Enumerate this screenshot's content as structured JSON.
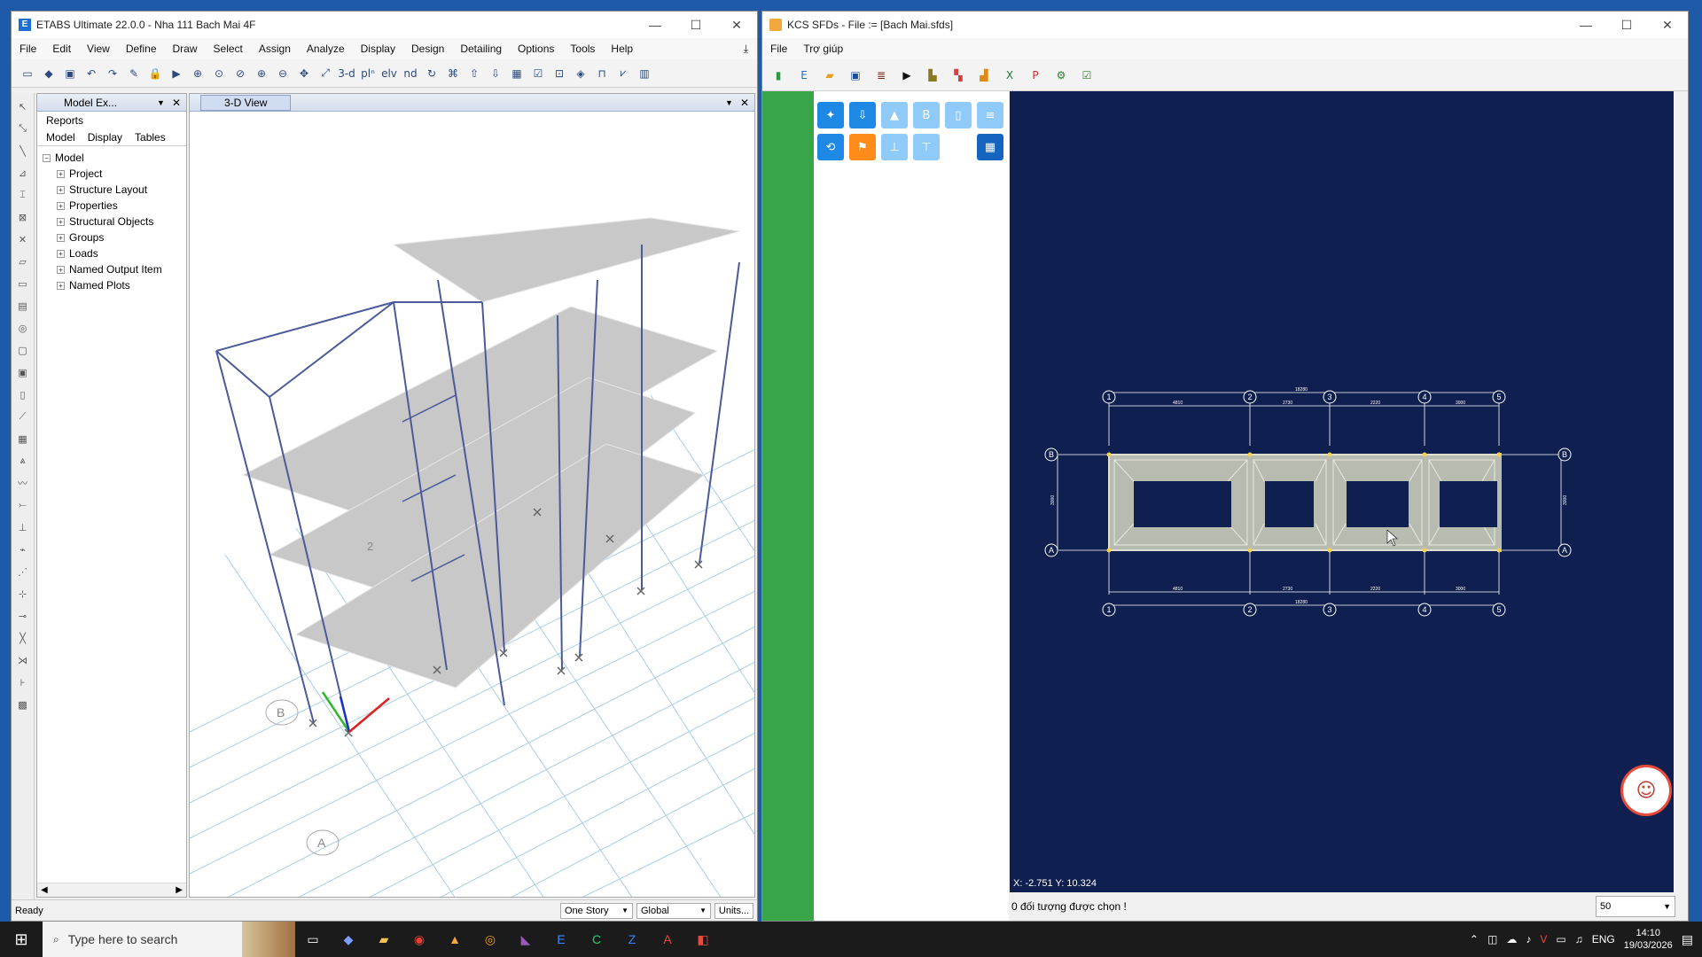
{
  "etabs": {
    "title": "ETABS Ultimate 22.0.0 - Nha 111 Bach Mai 4F",
    "menu": [
      "File",
      "Edit",
      "View",
      "Define",
      "Draw",
      "Select",
      "Assign",
      "Analyze",
      "Display",
      "Design",
      "Detailing",
      "Options",
      "Tools",
      "Help"
    ],
    "toolbar_text": {
      "view3d": "3-d",
      "plan": "plⁿ",
      "elev": "elv",
      "nd": "nd"
    },
    "explorer": {
      "tab_title": "Model Ex...",
      "reports": "Reports",
      "tabs": [
        "Model",
        "Display",
        "Tables"
      ],
      "root": "Model",
      "items": [
        "Project",
        "Structure Layout",
        "Properties",
        "Structural Objects",
        "Groups",
        "Loads",
        "Named Output Item",
        "Named Plots"
      ]
    },
    "view_tab": "3-D View",
    "model_labels": {
      "slab_label_1": "2",
      "grid_b": "B",
      "grid_a": "A"
    },
    "status": {
      "ready": "Ready",
      "story": "One Story",
      "coord": "Global",
      "units": "Units..."
    }
  },
  "kcs": {
    "title": "KCS SFDs - File := [Bach Mai.sfds]",
    "menu": [
      "File",
      "Trợ giúp"
    ],
    "coords": "X: -2.751  Y: 10.324",
    "status": "0 đối tượng được chọn !",
    "zoom": "50",
    "grid_numbers": [
      "1",
      "2",
      "3",
      "4",
      "5"
    ],
    "grid_letters": [
      "B",
      "A"
    ],
    "dims": [
      "4810",
      "2730",
      "2220",
      "3000"
    ],
    "total_dim": "18280",
    "side_dim": "3000",
    "palette_buttons": [
      "B"
    ]
  },
  "taskbar": {
    "search_placeholder": "Type here to search",
    "lang": "ENG",
    "time": "14:10",
    "date": "19/03/2026"
  },
  "colors": {
    "canvas_bg": "#0f1f4f",
    "frame": "#4a5a9a",
    "slab": "#c8c8c8",
    "panel": "#3aa64a",
    "accent": "#1e88e5"
  }
}
